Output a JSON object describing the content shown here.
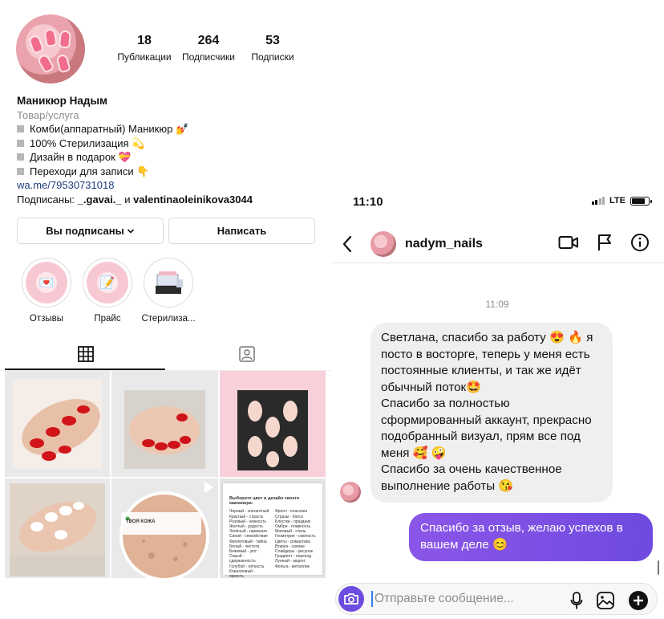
{
  "profile": {
    "stats": [
      {
        "value": "18",
        "label": "Публикации"
      },
      {
        "value": "264",
        "label": "Подписчики"
      },
      {
        "value": "53",
        "label": "Подписки"
      }
    ],
    "name": "Маникюр Надым",
    "category": "Товар/услуга",
    "bio_lines": [
      "Комби(аппаратный) Маникюр 💅",
      "100% Стерилизация 💫",
      "Дизайн в подарок 💝",
      "Переходи для записи 👇"
    ],
    "link": "wa.me/79530731018",
    "followed_prefix": "Подписаны: ",
    "followed_users": "_.gavai._",
    "followed_and": " и ",
    "followed_user2": "valentinaoleinikova3044",
    "follow_button": "Вы подписаны",
    "message_button": "Написать",
    "highlights": [
      {
        "label": "Отзывы",
        "icon": "💌"
      },
      {
        "label": "Прайс",
        "icon": "📝"
      },
      {
        "label": "Стерилиза..."
      }
    ],
    "doc_post": {
      "title": "Выберите цвет и дизайн своего маникюра:",
      "col1": [
        "Черный - элегантный",
        "Красный - страсть",
        "Розовый - нежность",
        "Желтый - радость",
        "Зелёный - гармония",
        "Синий - спокойствие",
        "Фиолетовый - тайна",
        "Белый - чистота",
        "Бежевый - уют",
        "Серый - сдержанность",
        "Голубой - лёгкость",
        "Коралловый - яркость",
        "Мятный - свежесть"
      ],
      "col2": [
        "Френч - классика",
        "Стразы - блеск",
        "Блестки - праздник",
        "Омбре - плавность",
        "Матовый - стиль",
        "Геометрия - смелость",
        "Цветы - романтика",
        "Втирка - сияние",
        "Слайдеры - рисунок",
        "Градиент - переход",
        "Лунный - акцент",
        "Фольга - металлик"
      ]
    },
    "skin_post": {
      "badge": "ТВОЯ КОЖА"
    }
  },
  "chat": {
    "status_time": "11:10",
    "network": "LTE",
    "username": "nadym_nails",
    "timestamp": "11:09",
    "incoming": [
      "Светлана, спасибо за работу 😍 🔥 я посто в восторге, теперь у меня есть постоянные клиенты, и так же идёт обычный поток🤩",
      "Спасибо за полностью сформированный аккаунт, прекрасно подобранный визуал, прям все под меня 🥰 🤪",
      "Спасибо за очень качественное выполнение работы 😘"
    ],
    "outgoing": "Спасибо за отзыв, желаю успехов в вашем деле 😊",
    "composer_placeholder": "Отправьте сообщение..."
  },
  "colors": {
    "accent": "#7b4ce6",
    "camera": "#6c4ddf",
    "link": "#1d3d7a"
  }
}
